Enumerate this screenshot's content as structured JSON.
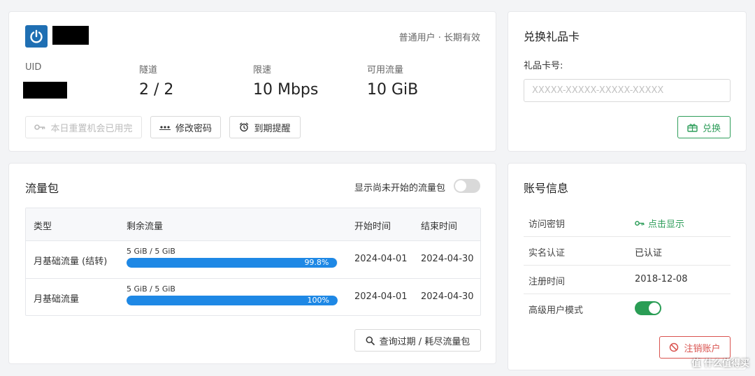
{
  "user_card": {
    "user_type": "普通用户 · 长期有效",
    "stats": [
      {
        "label": "UID",
        "value": ""
      },
      {
        "label": "隧道",
        "value": "2 / 2"
      },
      {
        "label": "限速",
        "value": "10 Mbps"
      },
      {
        "label": "可用流量",
        "value": "10 GiB"
      }
    ],
    "buttons": {
      "reset": "本日重置机会已用完",
      "change_password": "修改密码",
      "expiry_reminder": "到期提醒"
    }
  },
  "gift_card": {
    "title": "兑换礼品卡",
    "field_label": "礼品卡号:",
    "placeholder": "XXXXX-XXXXX-XXXXX-XXXXX",
    "redeem_label": "兑换"
  },
  "traffic": {
    "title": "流量包",
    "toggle_label": "显示尚未开始的流量包",
    "toggle_on": false,
    "columns": [
      "类型",
      "剩余流量",
      "开始时间",
      "结束时间"
    ],
    "rows": [
      {
        "type": "月基础流量 (结转)",
        "remaining": "5 GiB / 5 GiB",
        "percent_label": "99.8%",
        "fill": 0.998,
        "start": "2024-04-01",
        "end": "2024-04-30"
      },
      {
        "type": "月基础流量",
        "remaining": "5 GiB / 5 GiB",
        "percent_label": "100%",
        "fill": 1.0,
        "start": "2024-04-01",
        "end": "2024-04-30"
      }
    ],
    "query_button": "查询过期 / 耗尽流量包"
  },
  "account": {
    "title": "账号信息",
    "rows": [
      {
        "key": "访问密钥",
        "value": "点击显示"
      },
      {
        "key": "实名认证",
        "value": "已认证"
      },
      {
        "key": "注册时间",
        "value": "2018-12-08"
      },
      {
        "key": "高级用户模式",
        "value": ""
      }
    ],
    "advanced_mode_on": true,
    "cancel_button": "注销账户"
  },
  "watermark": "值 什么值得买",
  "colors": {
    "accent_green": "#2f9e5b",
    "progress_blue": "#1e88e5",
    "danger_red": "#d9534f",
    "logo_blue": "#1f6fb3"
  }
}
